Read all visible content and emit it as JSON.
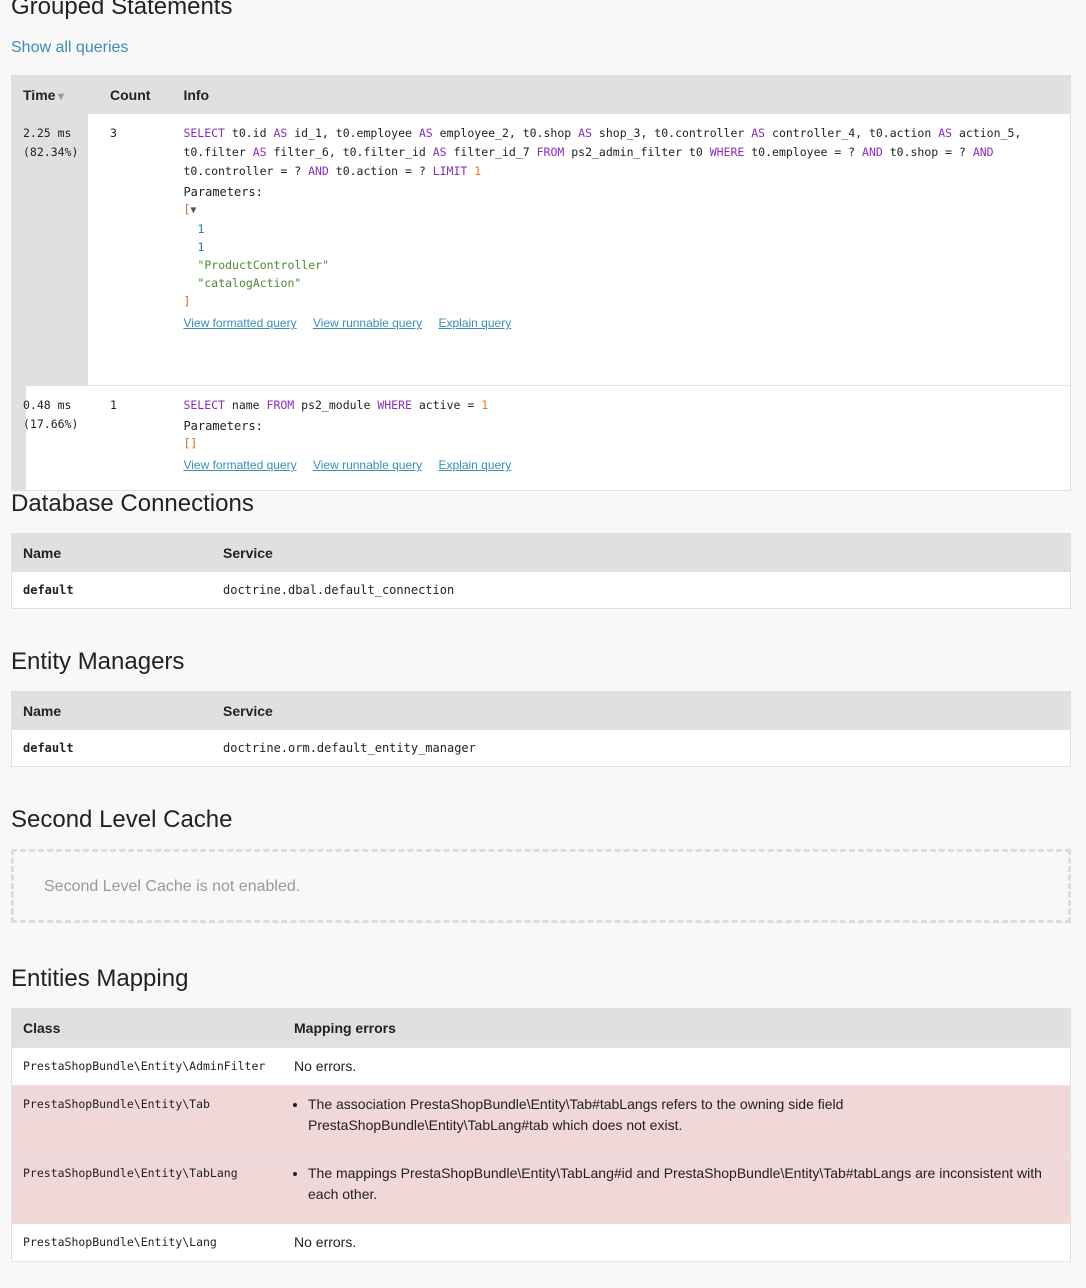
{
  "grouped": {
    "title": "Grouped Statements",
    "show_all": "Show all queries",
    "headers": {
      "time": "Time",
      "sort_icon": "▼",
      "count": "Count",
      "info": "Info"
    },
    "queries": [
      {
        "time": "2.25 ms",
        "pct": "(82.34%)",
        "count": "3",
        "params_label": "Parameters:",
        "params": [
          "1",
          "1",
          "\"ProductController\"",
          "\"catalogAction\""
        ],
        "open_bracket": "[",
        "toggle": "▼",
        "close_bracket": "]"
      },
      {
        "time": "0.48 ms",
        "pct": "(17.66%)",
        "count": "1",
        "params_label": "Parameters:",
        "empty_params": "[]"
      }
    ],
    "links": {
      "formatted": "View formatted query",
      "runnable": "View runnable query",
      "explain": "Explain query"
    }
  },
  "connections": {
    "title": "Database Connections",
    "headers": {
      "name": "Name",
      "service": "Service"
    },
    "rows": [
      {
        "name": "default",
        "service": "doctrine.dbal.default_connection"
      }
    ]
  },
  "managers": {
    "title": "Entity Managers",
    "headers": {
      "name": "Name",
      "service": "Service"
    },
    "rows": [
      {
        "name": "default",
        "service": "doctrine.orm.default_entity_manager"
      }
    ]
  },
  "cache": {
    "title": "Second Level Cache",
    "message": "Second Level Cache is not enabled."
  },
  "mapping": {
    "title": "Entities Mapping",
    "headers": {
      "class": "Class",
      "errors": "Mapping errors"
    },
    "rows": [
      {
        "class": "PrestaShopBundle\\Entity\\AdminFilter",
        "errors": "No errors."
      },
      {
        "class": "PrestaShopBundle\\Entity\\Tab",
        "errors": "The association PrestaShopBundle\\Entity\\Tab#tabLangs refers to the owning side field PrestaShopBundle\\Entity\\TabLang#tab which does not exist."
      },
      {
        "class": "PrestaShopBundle\\Entity\\TabLang",
        "errors": "The mappings PrestaShopBundle\\Entity\\TabLang#id and PrestaShopBundle\\Entity\\Tab#tabLangs are inconsistent with each other."
      },
      {
        "class": "PrestaShopBundle\\Entity\\Lang",
        "errors": "No errors."
      }
    ]
  }
}
